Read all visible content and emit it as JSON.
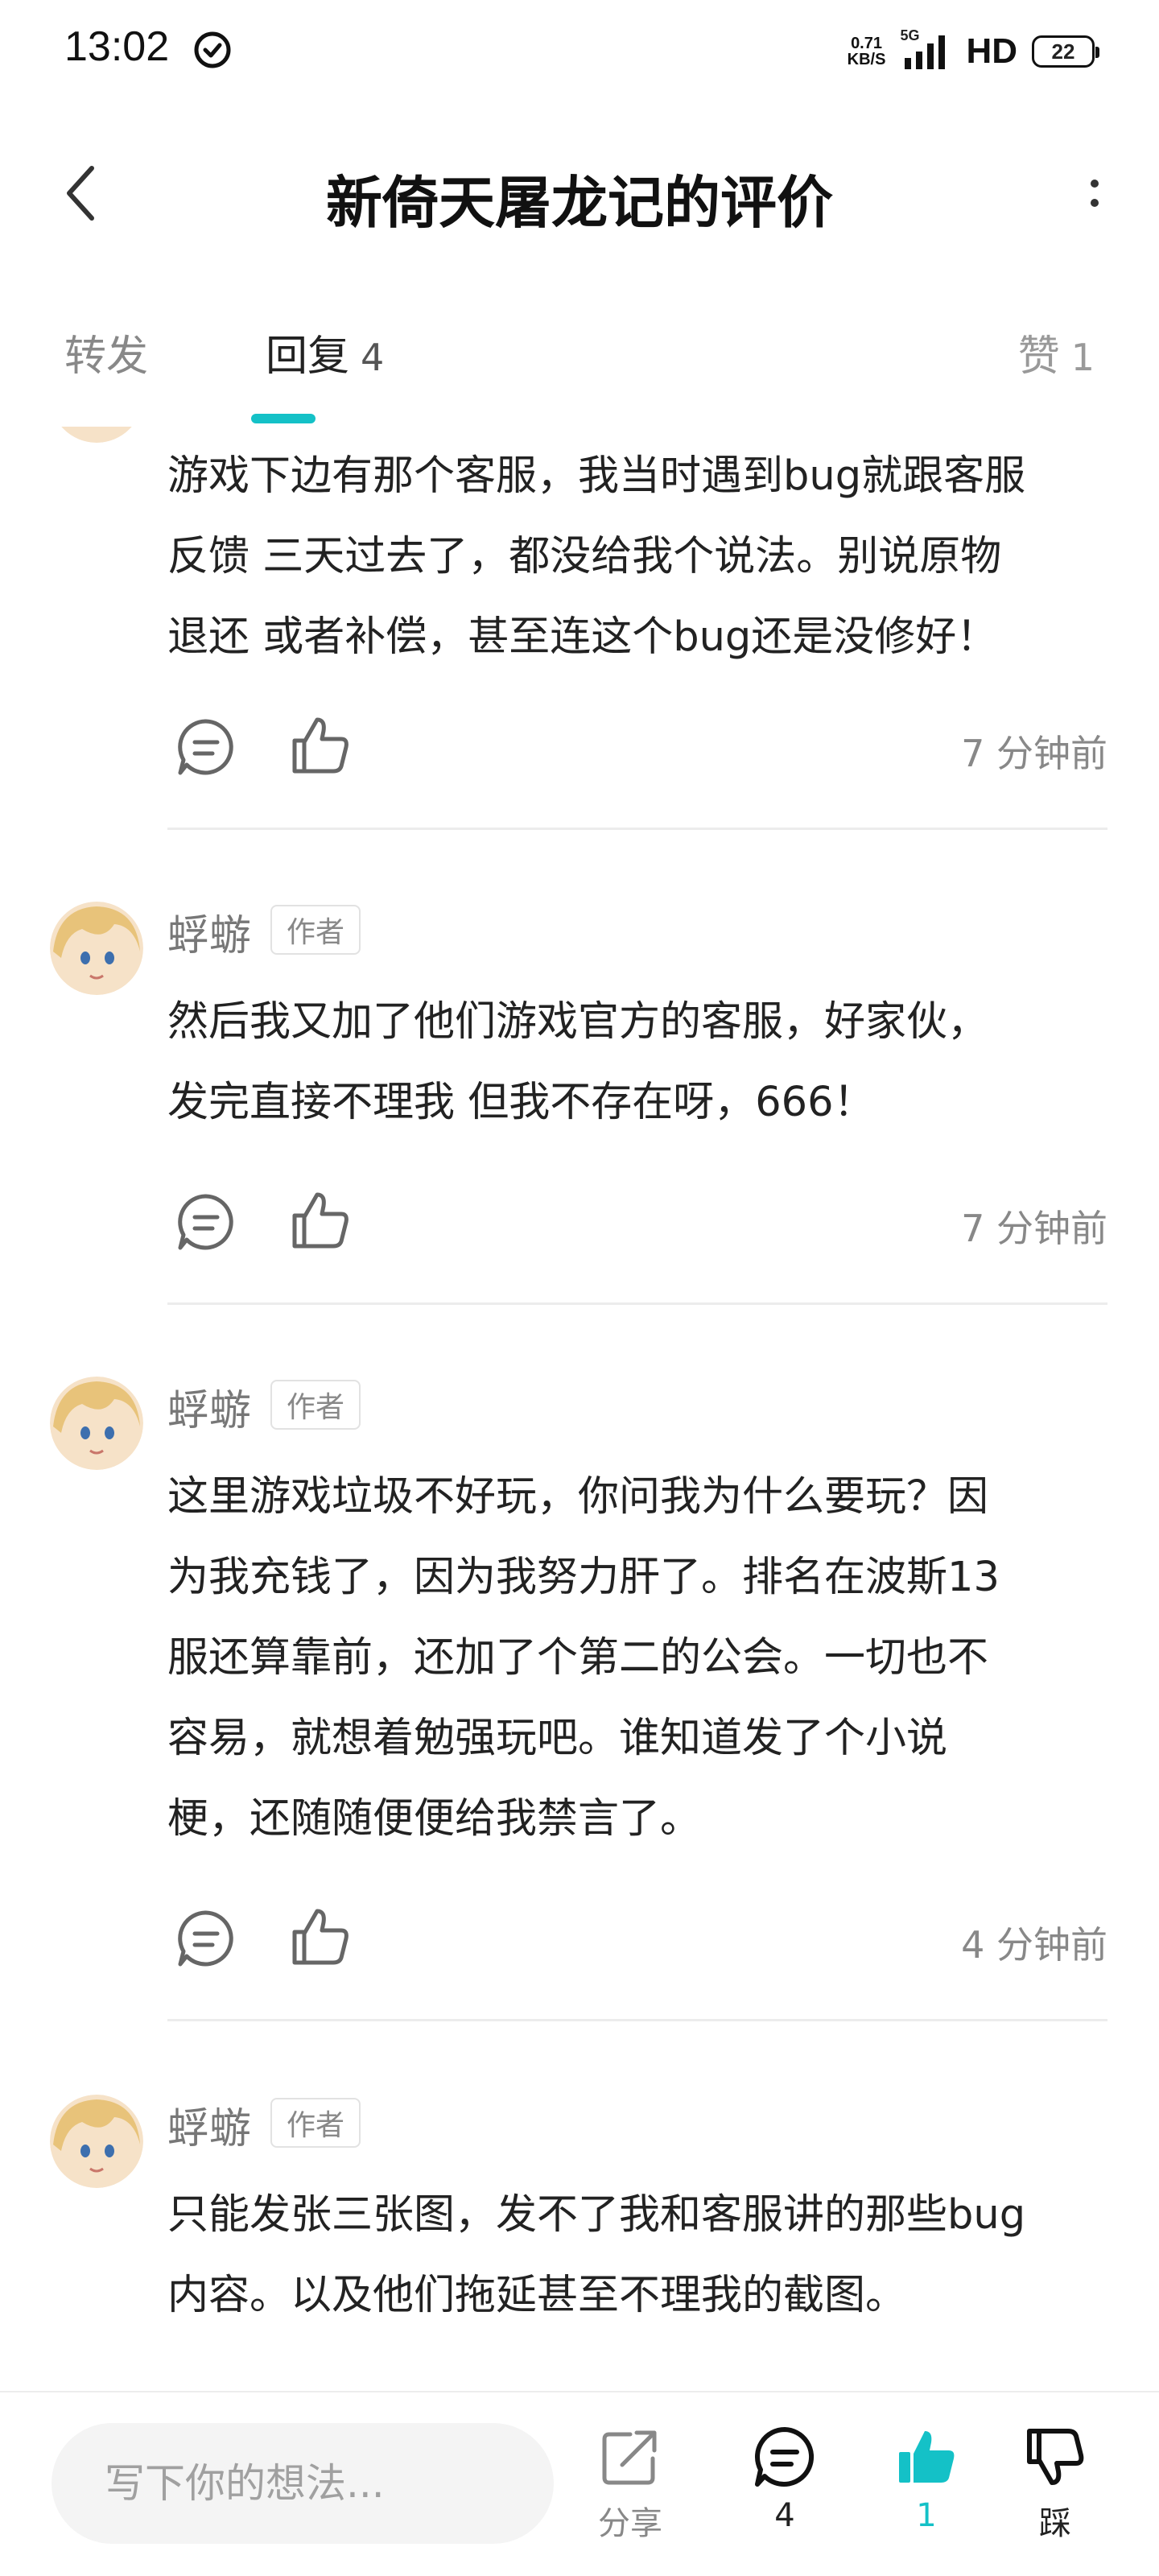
{
  "status_bar": {
    "time": "13:02",
    "net_speed_value": "0.71",
    "net_speed_unit": "KB/S",
    "network": "5G",
    "hd": "HD",
    "battery": "22"
  },
  "header": {
    "title": "新倚天屠龙记的评价"
  },
  "tabs": {
    "forward": "转发",
    "reply": "回复",
    "reply_count": "4",
    "like": "赞",
    "like_count": "1"
  },
  "accent_color": "#14c1c7",
  "comments": [
    {
      "text_lines": [
        "游戏下边有那个客服，我当时遇到bug就跟客服",
        "反馈 三天过去了，都没给我个说法。别说原物",
        "退还 或者补偿，甚至连这个bug还是没修好！"
      ],
      "time": "7 分钟前"
    },
    {
      "username": "蜉蝣",
      "badge": "作者",
      "text_lines": [
        "然后我又加了他们游戏官方的客服，好家伙，",
        "发完直接不理我 但我不存在呀，666！"
      ],
      "time": "7 分钟前"
    },
    {
      "username": "蜉蝣",
      "badge": "作者",
      "text_lines": [
        "这里游戏垃圾不好玩，你问我为什么要玩？因",
        "为我充钱了，因为我努力肝了。排名在波斯13",
        "服还算靠前，还加了个第二的公会。一切也不",
        "容易，就想着勉强玩吧。谁知道发了个小说",
        "梗，还随随便便给我禁言了。"
      ],
      "time": "4 分钟前"
    },
    {
      "username": "蜉蝣",
      "badge": "作者",
      "text_lines": [
        "只能发张三张图，发不了我和客服讲的那些bug",
        "内容。以及他们拖延甚至不理我的截图。"
      ]
    }
  ],
  "bottom_bar": {
    "input_placeholder": "写下你的想法...",
    "share_label": "分享",
    "comment_count": "4",
    "like_count": "1",
    "dislike_label": "踩"
  }
}
